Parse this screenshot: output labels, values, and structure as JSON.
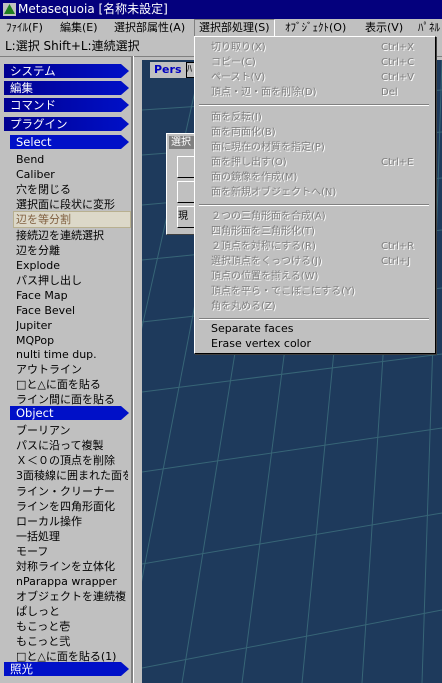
{
  "window": {
    "title": "Metasequoia [名称未設定]"
  },
  "menubar": {
    "file": "ﾌｧｲﾙ(F)",
    "edit": "編集(E)",
    "selattr": "選択部属性(A)",
    "selproc": "選択部処理(S)",
    "object": "ｵﾌﾞｼﾞｪｸﾄ(O)",
    "view": "表示(V)",
    "panel": "ﾊﾟﾈﾙ"
  },
  "statusline": "L:選択  Shift+L:連続選択",
  "left_panel": {
    "headers": {
      "system": "システム",
      "edit": "編集",
      "command": "コマンド",
      "plugin": "プラグイン",
      "select": "Select",
      "object": "Object",
      "light": "照光"
    },
    "select_items": [
      "Bend",
      "Caliber",
      "穴を閉じる",
      "選択面に段状に変形",
      "辺を等分割",
      "接続辺を連続選択",
      "辺を分離",
      "Explode",
      "パス押し出し",
      "Face Map",
      "Face Bevel",
      "Jupiter",
      "MQPop",
      "nulti time dup.",
      "アウトライン",
      "□と△に面を貼る",
      "ライン間に面を貼る"
    ],
    "object_items": [
      "ブーリアン",
      "パスに沿って複製",
      "Ｘ＜０の頂点を削除",
      "3面稜線に囲まれた面を",
      "ライン・クリーナー",
      "ラインを四角形面化",
      "ローカル操作",
      "一括処理",
      "モーフ",
      "対称ラインを立体化",
      "nParappa wrapper",
      "オブジェクトを連続複",
      "ぱしっと",
      "もこっと壱",
      "もこっと弐",
      "□と△に面を貼る(1)"
    ]
  },
  "viewport": {
    "tab": "Pers",
    "tab2": "ﾊ"
  },
  "dialog": {
    "title": "選択",
    "btn1": "",
    "btn2": "",
    "btn3": "現"
  },
  "dropdown": {
    "group1": [
      {
        "label": "切り取り(X)",
        "shortcut": "Ctrl+X"
      },
      {
        "label": "コピー(C)",
        "shortcut": "Ctrl+C"
      },
      {
        "label": "ペースト(V)",
        "shortcut": "Ctrl+V"
      },
      {
        "label": "頂点・辺・面を削除(D)",
        "shortcut": "Del"
      }
    ],
    "group2": [
      {
        "label": "面を反転(I)",
        "shortcut": ""
      },
      {
        "label": "面を両面化(B)",
        "shortcut": ""
      },
      {
        "label": "面に現在の材質を指定(P)",
        "shortcut": ""
      },
      {
        "label": "面を押し出す(O)",
        "shortcut": "Ctrl+E"
      },
      {
        "label": "面の鏡像を作成(M)",
        "shortcut": ""
      },
      {
        "label": "面を新規オブジェクトへ(N)",
        "shortcut": ""
      }
    ],
    "group3": [
      {
        "label": "２つの三角形面を合成(A)",
        "shortcut": ""
      },
      {
        "label": "四角形面を三角形化(T)",
        "shortcut": ""
      },
      {
        "label": "２頂点を対称にする(R)",
        "shortcut": "Ctrl+R"
      },
      {
        "label": "選択頂点をくっつける(J)",
        "shortcut": "Ctrl+J"
      },
      {
        "label": "頂点の位置を揃える(W)",
        "shortcut": ""
      },
      {
        "label": "頂点を平ら・でこぼこにする(Y)",
        "shortcut": ""
      },
      {
        "label": "角を丸める(Z)",
        "shortcut": ""
      }
    ],
    "group4": [
      {
        "label": "Separate faces",
        "shortcut": ""
      },
      {
        "label": "Erase vertex color",
        "shortcut": ""
      }
    ]
  }
}
